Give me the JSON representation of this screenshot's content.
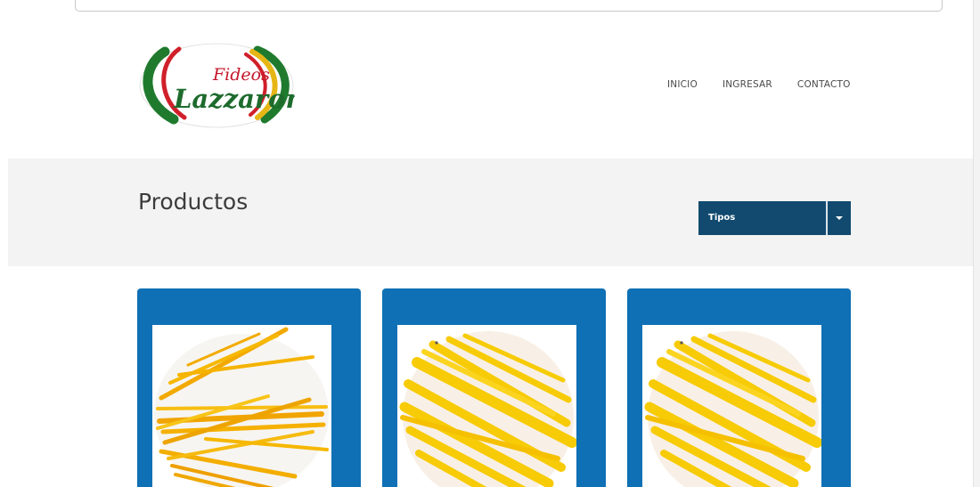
{
  "brand": {
    "logo_word_top": "Fideos",
    "logo_word_main": "Lazzaroni",
    "colors": {
      "green": "#1f7a2e",
      "red": "#d0202a",
      "gold": "#e6b615",
      "script_red": "#c4162a",
      "script_green": "#1d6b2d"
    }
  },
  "nav": {
    "items": [
      {
        "label": "INICIO"
      },
      {
        "label": "INGRESAR"
      },
      {
        "label": "CONTACTO"
      }
    ]
  },
  "products_section": {
    "title": "Productos",
    "filter": {
      "selected": "Tipos",
      "icon": "caret-down-icon"
    },
    "band_color": "#f3f3f3",
    "filter_color": "#124a6f"
  },
  "cards": {
    "accent": "#0f70b5",
    "items": [
      {
        "image": "spaghetti-bundle-image"
      },
      {
        "image": "spaghetti-strands-image"
      },
      {
        "image": "spaghetti-strands-image"
      }
    ]
  }
}
